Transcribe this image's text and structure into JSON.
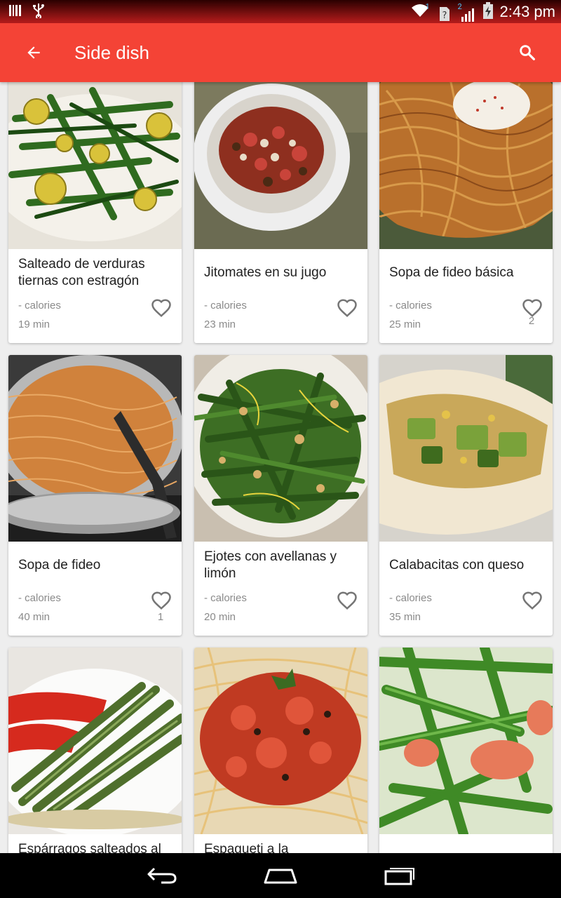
{
  "status_bar": {
    "time": "2:43 pm",
    "sim1_label": "1",
    "sim2_label": "2",
    "icons": [
      "barcode-icon",
      "usb-icon",
      "wifi-icon",
      "sim-unknown-icon",
      "signal-icon",
      "battery-charging-icon"
    ]
  },
  "app_bar": {
    "title": "Side dish",
    "back_icon": "arrow-back-icon",
    "search_icon": "search-icon",
    "color": "#f44336"
  },
  "recipes": [
    {
      "name": "Salteado de verduras tiernas con estragón",
      "calories": "- calories",
      "time": "19 min",
      "favorites": ""
    },
    {
      "name": "Jitomates en su jugo",
      "calories": "- calories",
      "time": "23 min",
      "favorites": ""
    },
    {
      "name": "Sopa de fideo básica",
      "calories": "- calories",
      "time": "25 min",
      "favorites": "2"
    },
    {
      "name": "Sopa de fideo",
      "calories": "- calories",
      "time": "40 min",
      "favorites": "1"
    },
    {
      "name": "Ejotes con avellanas y limón",
      "calories": "- calories",
      "time": "20 min",
      "favorites": ""
    },
    {
      "name": "Calabacitas con queso",
      "calories": "- calories",
      "time": "35 min",
      "favorites": ""
    },
    {
      "name": "Espárragos salteados al",
      "calories": "",
      "time": "",
      "favorites": ""
    },
    {
      "name": "Espagueti a la",
      "calories": "",
      "time": "",
      "favorites": ""
    },
    {
      "name": "",
      "calories": "",
      "time": "",
      "favorites": ""
    }
  ],
  "nav_bar": {
    "icons": [
      "back-nav-icon",
      "home-nav-icon",
      "recents-nav-icon"
    ]
  }
}
